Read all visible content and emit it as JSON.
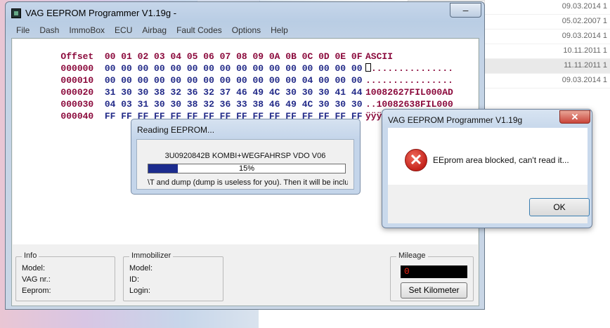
{
  "background": {
    "dates": [
      "09.03.2014 1",
      "05.02.2007 1",
      "09.03.2014 1",
      "10.11.2011 1",
      "11.11.2011 1",
      "09.03.2014 1"
    ]
  },
  "main_window": {
    "title": "VAG EEPROM Programmer  V1.19g -",
    "minimize_glyph": "–",
    "menu": [
      "File",
      "Dash",
      "ImmoBox",
      "ECU",
      "Airbag",
      "Fault Codes",
      "Options",
      "Help"
    ],
    "hex": {
      "offset_header": "Offset",
      "columns": [
        "00",
        "01",
        "02",
        "03",
        "04",
        "05",
        "06",
        "07",
        "08",
        "09",
        "0A",
        "0B",
        "0C",
        "0D",
        "0E",
        "0F"
      ],
      "ascii_header": "ASCII",
      "rows": [
        {
          "offset": "000000",
          "bytes": "00 00 00 00 00 00 00 00 00 00 00 00 00 00 00 00",
          "ascii": "................"
        },
        {
          "offset": "000010",
          "bytes": "00 00 00 00 00 00 00 00 00 00 00 00 04 00 00 00",
          "ascii": "................"
        },
        {
          "offset": "000020",
          "bytes": "31 30 30 38 32 36 32 37 46 49 4C 30 30 30 41 44",
          "ascii": "10082627FIL000AD"
        },
        {
          "offset": "000030",
          "bytes": "04 03 31 30 30 38 32 36 33 38 46 49 4C 30 30 30",
          "ascii": "..10082638FIL000"
        },
        {
          "offset": "000040",
          "bytes": "FF FF FF FF FF FF FF FF FF FF FF FF FF FF FF FF",
          "ascii": "ÿÿÿÿÿÿÿÿÿÿÿÿÿÿÿÿ"
        }
      ]
    },
    "info": {
      "title": "Info",
      "model": "Model:",
      "vag_nr": "VAG nr.:",
      "eeprom": "Eeprom:"
    },
    "immobilizer": {
      "title": "Immobilizer",
      "model": "Model:",
      "id": "ID:",
      "login": "Login:"
    },
    "mileage": {
      "title": "Mileage",
      "value": "0",
      "set_button": "Set Kilometer"
    }
  },
  "progress_dialog": {
    "title": "Reading EEPROM...",
    "file": "3U0920842B  KOMBI+WEGFAHRSP VDO V06",
    "percent_value": 15,
    "percent_label": "15%",
    "message": "\\T and dump (dump is useless for you). Then it will be includ"
  },
  "error_dialog": {
    "title": "VAG EEPROM Programmer  V1.19g",
    "close_glyph": "✕",
    "icon_glyph": "✕",
    "message": "EEprom area blocked, can't read it...",
    "ok_label": "OK"
  }
}
